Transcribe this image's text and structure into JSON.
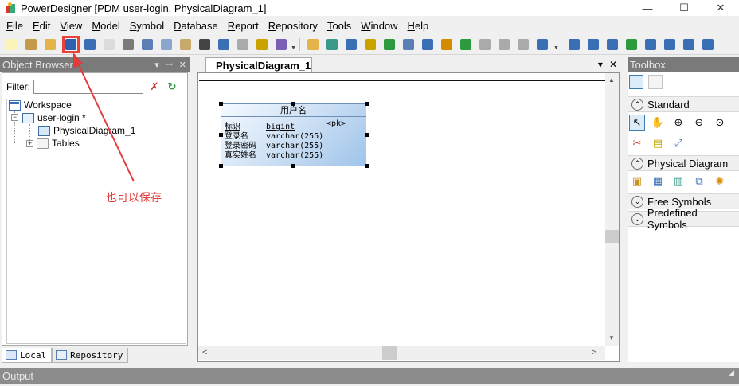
{
  "window": {
    "title": "PowerDesigner [PDM user-login, PhysicalDiagram_1]",
    "minimize": "—",
    "maximize": "☐",
    "close": "✕"
  },
  "menu": [
    {
      "label": "File",
      "u": "F",
      "rest": "ile"
    },
    {
      "label": "Edit",
      "u": "E",
      "rest": "dit"
    },
    {
      "label": "View",
      "u": "V",
      "rest": "iew"
    },
    {
      "label": "Model",
      "u": "M",
      "rest": "odel"
    },
    {
      "label": "Symbol",
      "u": "S",
      "rest": "ymbol"
    },
    {
      "label": "Database",
      "u": "D",
      "rest": "atabase"
    },
    {
      "label": "Report",
      "u": "R",
      "rest": "eport"
    },
    {
      "label": "Repository",
      "u": "R",
      "rest": "epository"
    },
    {
      "label": "Tools",
      "u": "T",
      "rest": "ools"
    },
    {
      "label": "Window",
      "u": "W",
      "rest": "indow"
    },
    {
      "label": "Help",
      "u": "H",
      "rest": "elp"
    }
  ],
  "toolbar": {
    "icons": [
      "new-icon",
      "open-icon",
      "open-folder-icon",
      "save-icon",
      "save-all-icon",
      "print-preview-icon",
      "print-icon",
      "cut-icon",
      "copy-icon",
      "paste-icon",
      "delete-icon",
      "undo-icon",
      "redo-icon",
      "properties-icon",
      "check-model-icon",
      "new-model-icon",
      "generate-icon",
      "reverse-icon",
      "impact-icon",
      "compare-icon",
      "merge-icon",
      "apply-model-icon",
      "format-painter-icon",
      "font-icon",
      "cascade-icon",
      "back-icon",
      "forward-icon",
      "layout-1-icon",
      "layout-2-icon",
      "layout-3-icon",
      "layout-4-icon",
      "layout-5-icon",
      "layout-6-icon",
      "browser-icon",
      "output-icon",
      "result-icon"
    ],
    "highlighted": "save-icon"
  },
  "object_browser": {
    "title": "Object Browser",
    "filter_label": "Filter:",
    "filter_value": "",
    "tree": {
      "workspace": "Workspace",
      "model": "user-login *",
      "diagram": "PhysicalDiagram_1",
      "tables": "Tables"
    },
    "tabs": {
      "local": "Local",
      "repository": "Repository"
    }
  },
  "diagram": {
    "tab_label": "PhysicalDiagram_1",
    "entity": {
      "title": "用户名",
      "columns": [
        {
          "name": "标识",
          "type": "bigint",
          "key": "<pk>"
        },
        {
          "name": "登录名",
          "type": "varchar(255)",
          "key": ""
        },
        {
          "name": "登录密码",
          "type": "varchar(255)",
          "key": ""
        },
        {
          "name": "真实姓名",
          "type": "varchar(255)",
          "key": ""
        }
      ]
    }
  },
  "annotation": {
    "text": "也可以保存",
    "color": "#e23b3b"
  },
  "toolbox": {
    "title": "Toolbox",
    "sections": {
      "standard": "Standard",
      "physical": "Physical Diagram",
      "free": "Free Symbols",
      "predefined": "Predefined Symbols"
    }
  },
  "output": {
    "title": "Output"
  }
}
